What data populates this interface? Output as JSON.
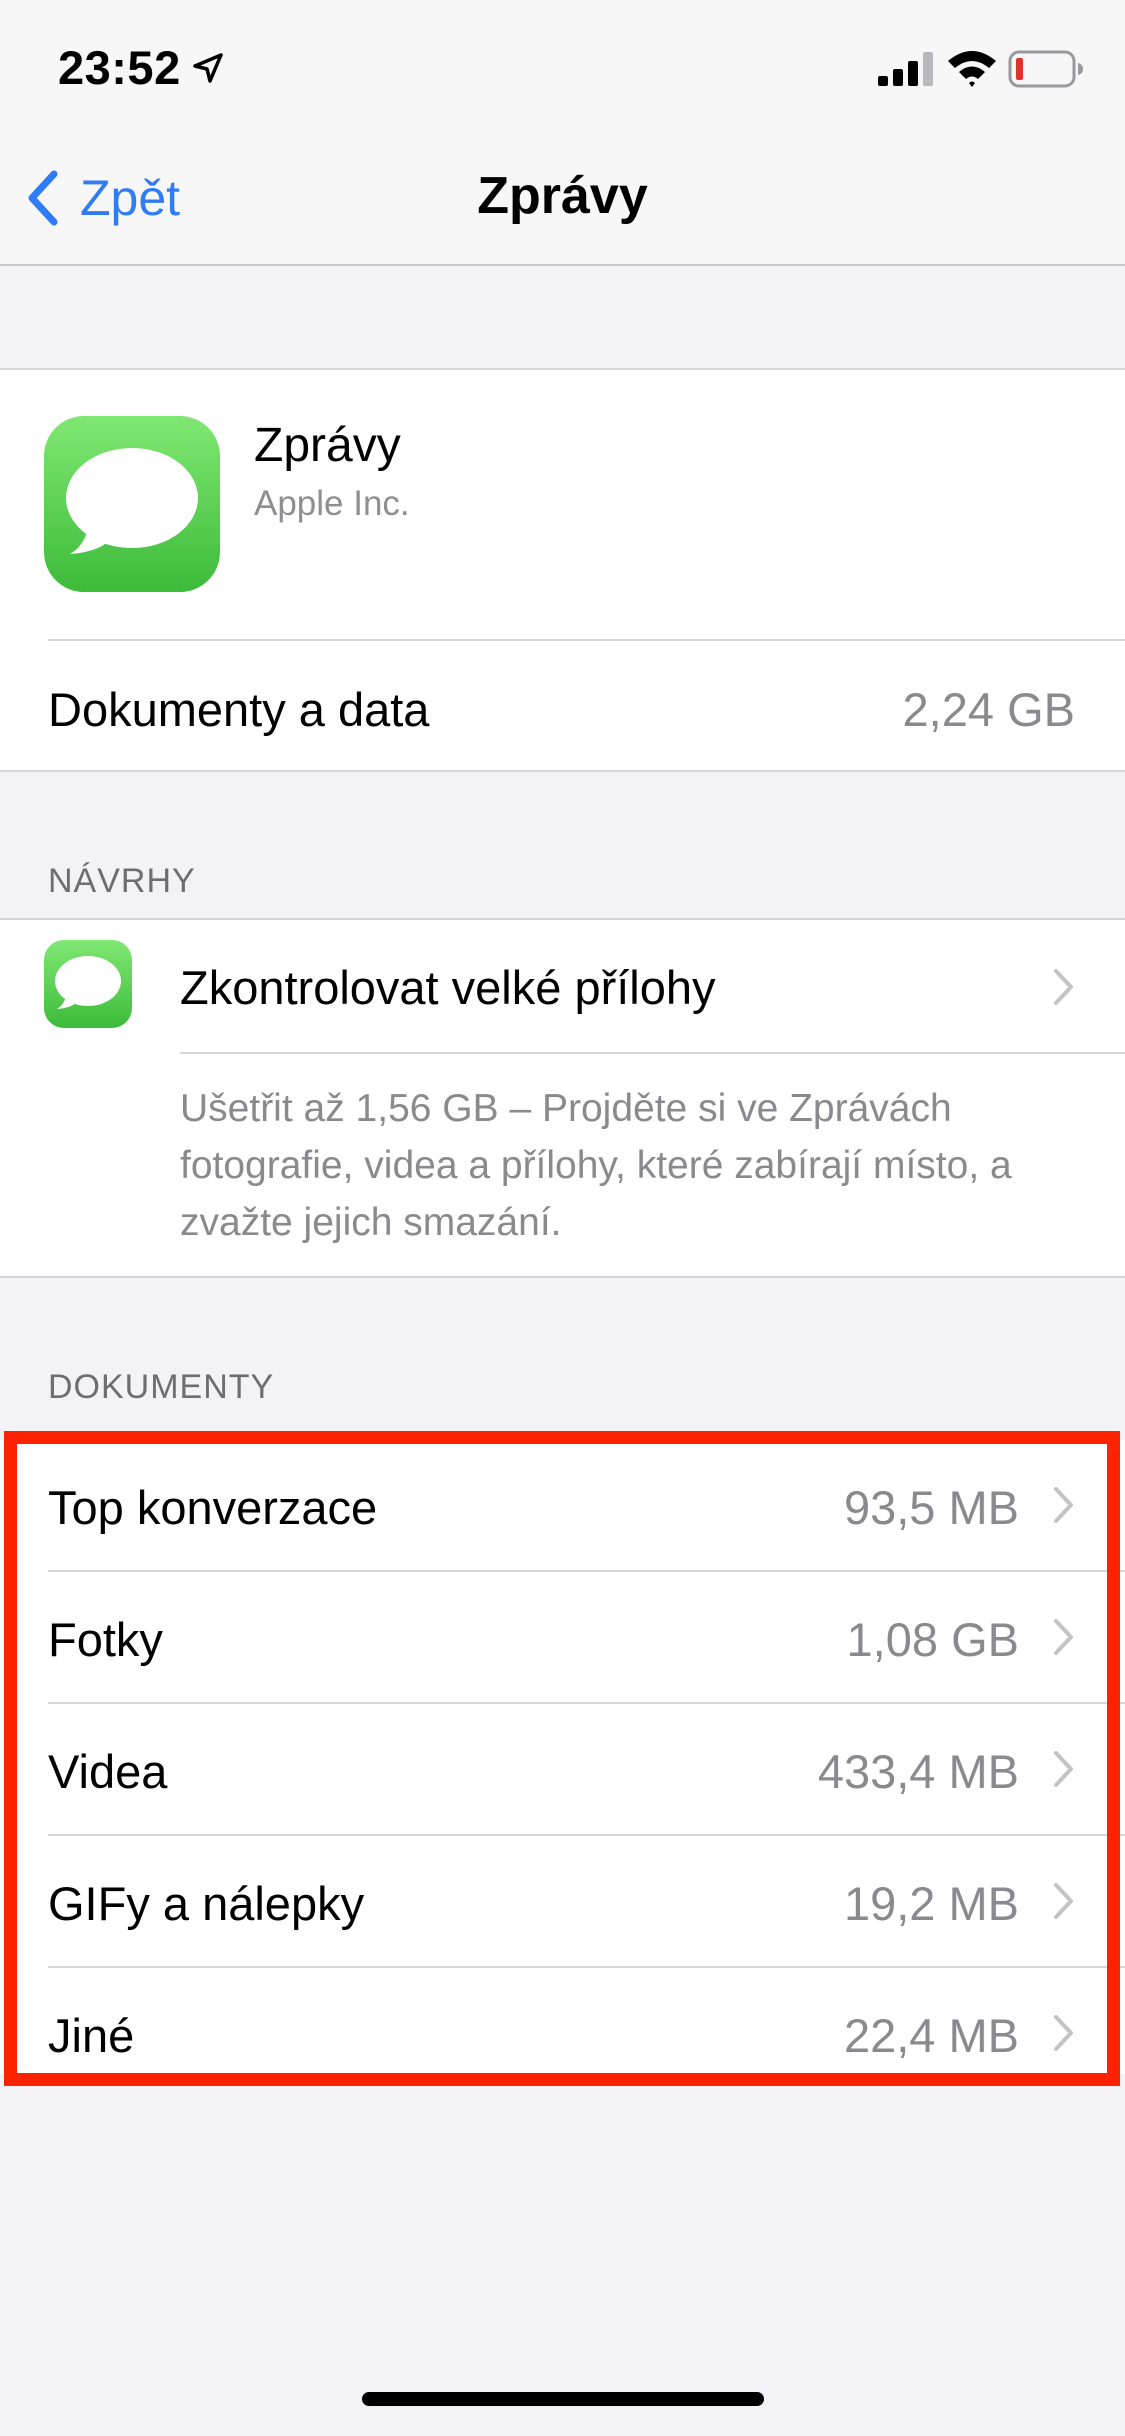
{
  "status_bar": {
    "time": "23:52",
    "icons": [
      "location-arrow-icon",
      "cellular-signal-icon",
      "wifi-icon",
      "battery-low-icon"
    ],
    "battery_color": "#e0322a"
  },
  "nav": {
    "back_label": "Zpět",
    "title": "Zprávy",
    "accent": "#2f7cf6"
  },
  "app": {
    "name": "Zprávy",
    "vendor": "Apple Inc.",
    "icon": "messages-app-icon",
    "data_label": "Dokumenty a data",
    "data_value": "2,24 GB"
  },
  "suggestions": {
    "header": "NÁVRHY",
    "title": "Zkontrolovat velké přílohy",
    "description": "Ušetřit až 1,56 GB – Projděte si ve Zprávách fotografie, videa a přílohy, které zabírají místo, a zvažte jejich smazání."
  },
  "documents": {
    "header": "DOKUMENTY",
    "rows": [
      {
        "label": "Top konverzace",
        "value": "93,5 MB"
      },
      {
        "label": "Fotky",
        "value": "1,08 GB"
      },
      {
        "label": "Videa",
        "value": "433,4 MB"
      },
      {
        "label": "GIFy a nálepky",
        "value": "19,2 MB"
      },
      {
        "label": "Jiné",
        "value": "22,4 MB"
      }
    ],
    "highlight_color": "#fe2200"
  }
}
